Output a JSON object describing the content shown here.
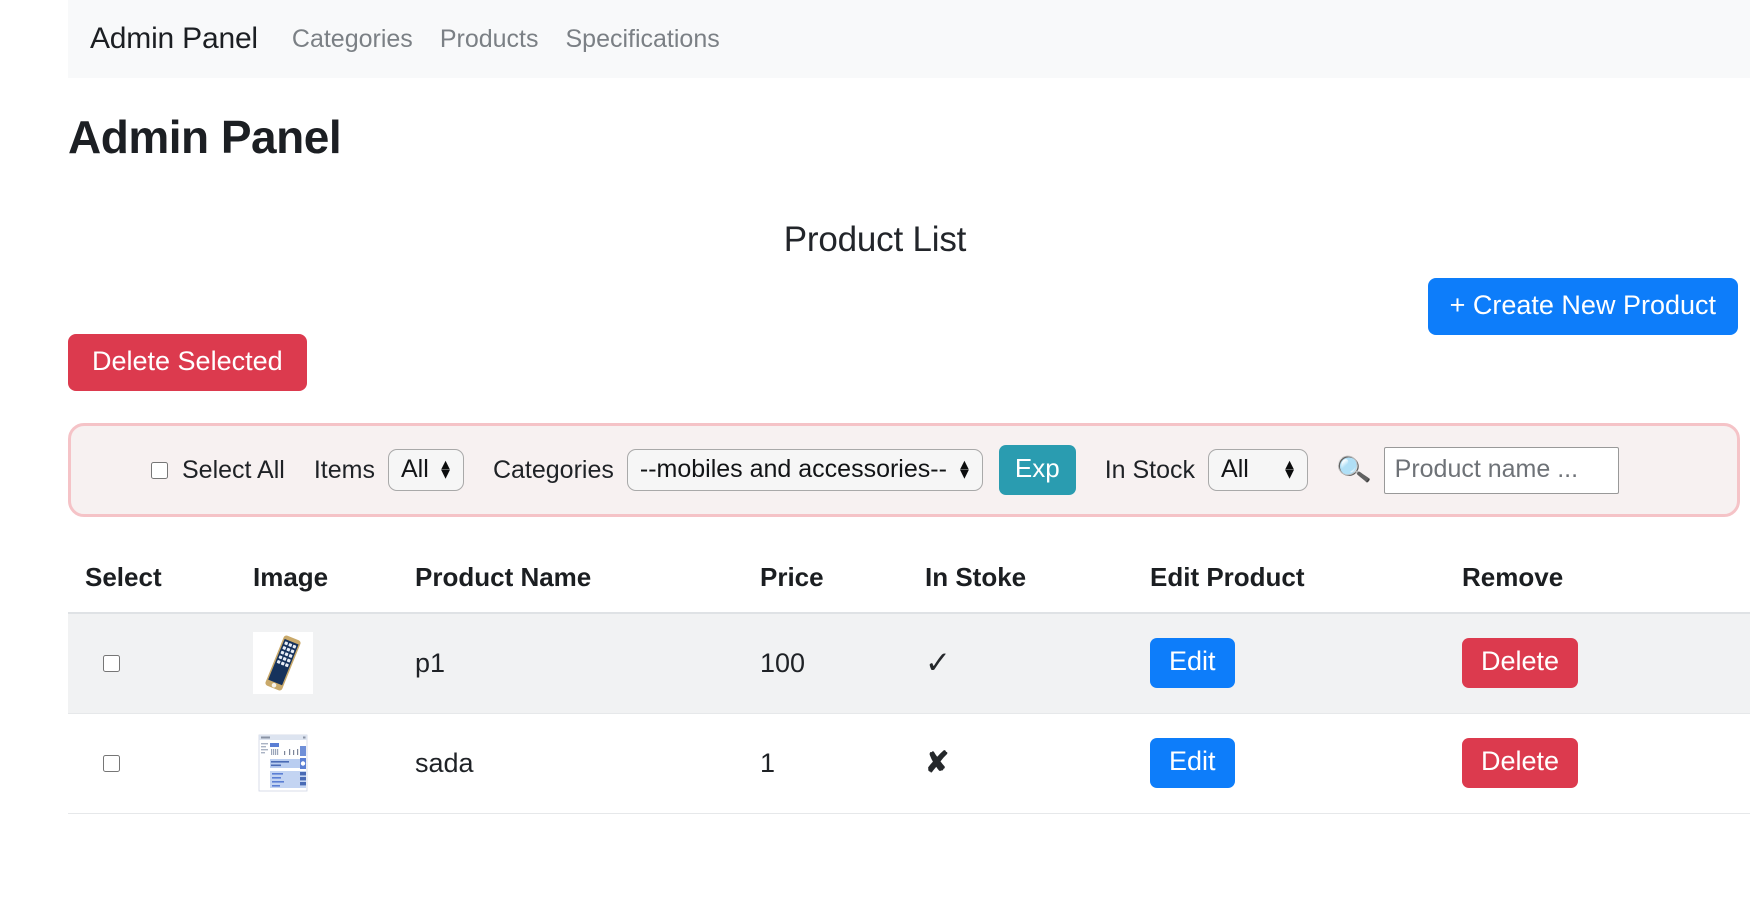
{
  "navbar": {
    "brand": "Admin Panel",
    "links": [
      {
        "label": "Categories"
      },
      {
        "label": "Products"
      },
      {
        "label": "Specifications"
      }
    ]
  },
  "page": {
    "title": "Admin Panel",
    "list_heading": "Product List"
  },
  "actions": {
    "create_label": "+ Create New Product",
    "delete_selected_label": "Delete Selected",
    "create_color": "#0d7dfa",
    "delete_color": "#dc3a4e"
  },
  "filters": {
    "select_all_label": "Select All",
    "items_label": "Items",
    "items_value": "All",
    "categories_label": "Categories",
    "categories_value": "--mobiles and accessories--",
    "export_label": "Exp",
    "export_color": "#2a9cb0",
    "in_stock_label": "In Stock",
    "in_stock_value": "All",
    "search_icon": "search-icon",
    "search_placeholder": "Product name ...",
    "search_value": "",
    "border_color": "#f5c3c7",
    "background_color": "#f7f1f1"
  },
  "table": {
    "columns": [
      "Select",
      "Image",
      "Product Name",
      "Price",
      "In Stoke",
      "Edit Product",
      "Remove"
    ],
    "rows": [
      {
        "selected": false,
        "image_alt": "smartphone-thumbnail",
        "name": "p1",
        "price": "100",
        "in_stock": true,
        "in_stock_glyph": "✓",
        "edit_label": "Edit",
        "remove_label": "Delete"
      },
      {
        "selected": false,
        "image_alt": "screenshot-thumbnail",
        "name": "sada",
        "price": "1",
        "in_stock": false,
        "in_stock_glyph": "✘",
        "edit_label": "Edit",
        "remove_label": "Delete"
      }
    ]
  }
}
